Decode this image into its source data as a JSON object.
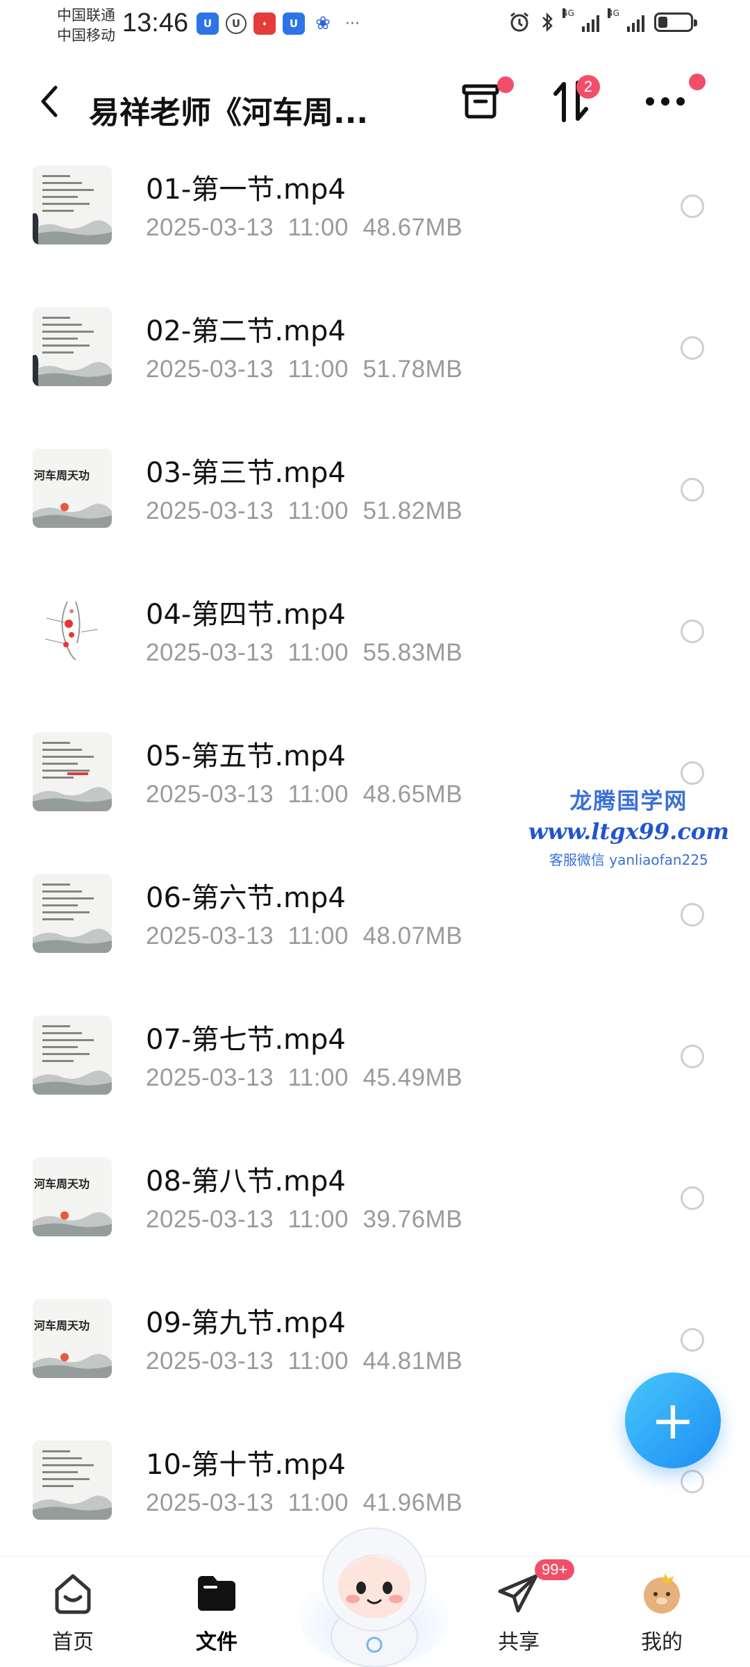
{
  "status_bar": {
    "carrier_1": "中国联通",
    "carrier_2": "中国移动",
    "time": "13:46",
    "signal_1": "4G",
    "signal_2": "4G",
    "battery_level": 0.3
  },
  "header": {
    "title": "易祥老师《河车周...",
    "transfer_badge": "2"
  },
  "files": [
    {
      "name": "01-第一节.mp4",
      "date": "2025-03-13",
      "time": "11:00",
      "size": "48.67MB",
      "thumb_text": ""
    },
    {
      "name": "02-第二节.mp4",
      "date": "2025-03-13",
      "time": "11:00",
      "size": "51.78MB",
      "thumb_text": ""
    },
    {
      "name": "03-第三节.mp4",
      "date": "2025-03-13",
      "time": "11:00",
      "size": "51.82MB",
      "thumb_text": "河车周天功"
    },
    {
      "name": "04-第四节.mp4",
      "date": "2025-03-13",
      "time": "11:00",
      "size": "55.83MB",
      "thumb_text": ""
    },
    {
      "name": "05-第五节.mp4",
      "date": "2025-03-13",
      "time": "11:00",
      "size": "48.65MB",
      "thumb_text": ""
    },
    {
      "name": "06-第六节.mp4",
      "date": "2025-03-13",
      "time": "11:00",
      "size": "48.07MB",
      "thumb_text": ""
    },
    {
      "name": "07-第七节.mp4",
      "date": "2025-03-13",
      "time": "11:00",
      "size": "45.49MB",
      "thumb_text": ""
    },
    {
      "name": "08-第八节.mp4",
      "date": "2025-03-13",
      "time": "11:00",
      "size": "39.76MB",
      "thumb_text": "河车周天功"
    },
    {
      "name": "09-第九节.mp4",
      "date": "2025-03-13",
      "time": "11:00",
      "size": "44.81MB",
      "thumb_text": "河车周天功"
    },
    {
      "name": "10-第十节.mp4",
      "date": "2025-03-13",
      "time": "11:00",
      "size": "41.96MB",
      "thumb_text": ""
    }
  ],
  "watermark": {
    "title": "龙腾国学网",
    "url": "www.ltgx99.com",
    "contact": "客服微信 yanliaofan225"
  },
  "bottom_nav": {
    "home": "首页",
    "files": "文件",
    "share": "共享",
    "share_badge": "99+",
    "mine": "我的"
  },
  "colors": {
    "accent": "#1e8cf3",
    "badge": "#f14f69",
    "meta_text": "#9a9a9a"
  }
}
